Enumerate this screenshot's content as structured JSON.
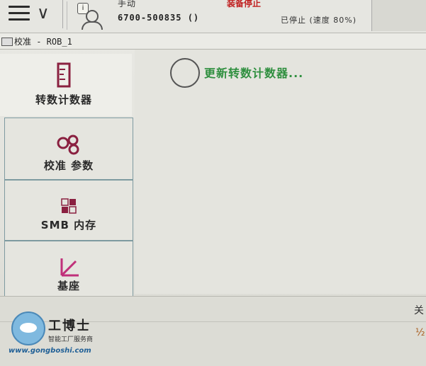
{
  "header": {
    "mode": "手动",
    "controller_id": "6700-500835 ()",
    "motor_state": "装备停止",
    "status": "已停止 (速度 80%)"
  },
  "window": {
    "title": "校准 - ROB_1"
  },
  "sidebar": {
    "items": [
      {
        "label": "转数计数器",
        "icon": "ruler-icon",
        "active": true
      },
      {
        "label": "校准 参数",
        "icon": "gears-icon",
        "active": false
      },
      {
        "label": "SMB 内存",
        "icon": "memory-icon",
        "active": false
      },
      {
        "label": "基座",
        "icon": "axis-icon",
        "active": false
      }
    ]
  },
  "main": {
    "message": "更新转数计数器..."
  },
  "footer": {
    "edge_text_1": "关",
    "edge_text_2": "½"
  },
  "watermark": {
    "brand": "工博士",
    "tagline": "智能工厂服务商",
    "url": "www.gongboshi.com"
  },
  "colors": {
    "message": "#2f8f3f",
    "motor_state": "#c02020",
    "url": "#1f5f96"
  }
}
